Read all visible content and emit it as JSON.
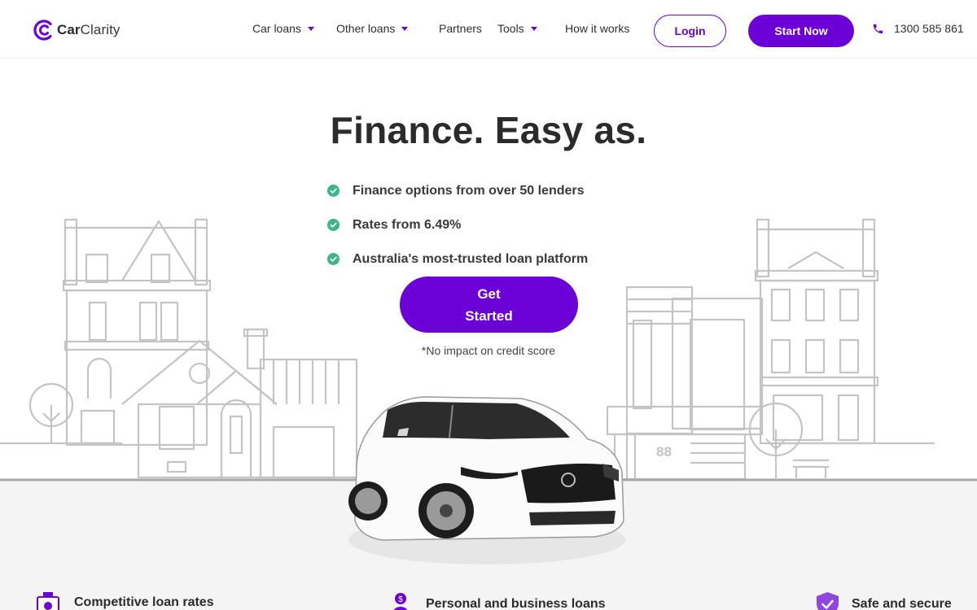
{
  "brand": {
    "name_part1": "Car",
    "name_part2": "Clarity",
    "accent": "#6b00d7"
  },
  "nav": {
    "items": [
      {
        "label": "Car loans",
        "has_dropdown": true
      },
      {
        "label": "Other loans",
        "has_dropdown": true
      },
      {
        "label": "Partners",
        "has_dropdown": false
      },
      {
        "label": "Tools",
        "has_dropdown": true
      },
      {
        "label": "How it works",
        "has_dropdown": false
      }
    ],
    "login_label": "Login",
    "start_label": "Start Now",
    "phone": "1300 585 861",
    "phone_icon": "phone-icon"
  },
  "hero": {
    "title": "Finance. Easy as.",
    "features": [
      "Finance options from over 50 lenders",
      "Rates from 6.49%",
      "Australia's most-trusted loan platform"
    ],
    "check_color": "#3bb58a",
    "cta_label": "Get Started",
    "note": "*No impact on credit score",
    "house_number": "88"
  },
  "bottom_features": [
    {
      "icon": "rates-icon",
      "label": "Competitive loan rates"
    },
    {
      "icon": "person-dollar-icon",
      "label": "Personal and business loans"
    },
    {
      "icon": "shield-check-icon",
      "label": "Safe and secure"
    }
  ]
}
